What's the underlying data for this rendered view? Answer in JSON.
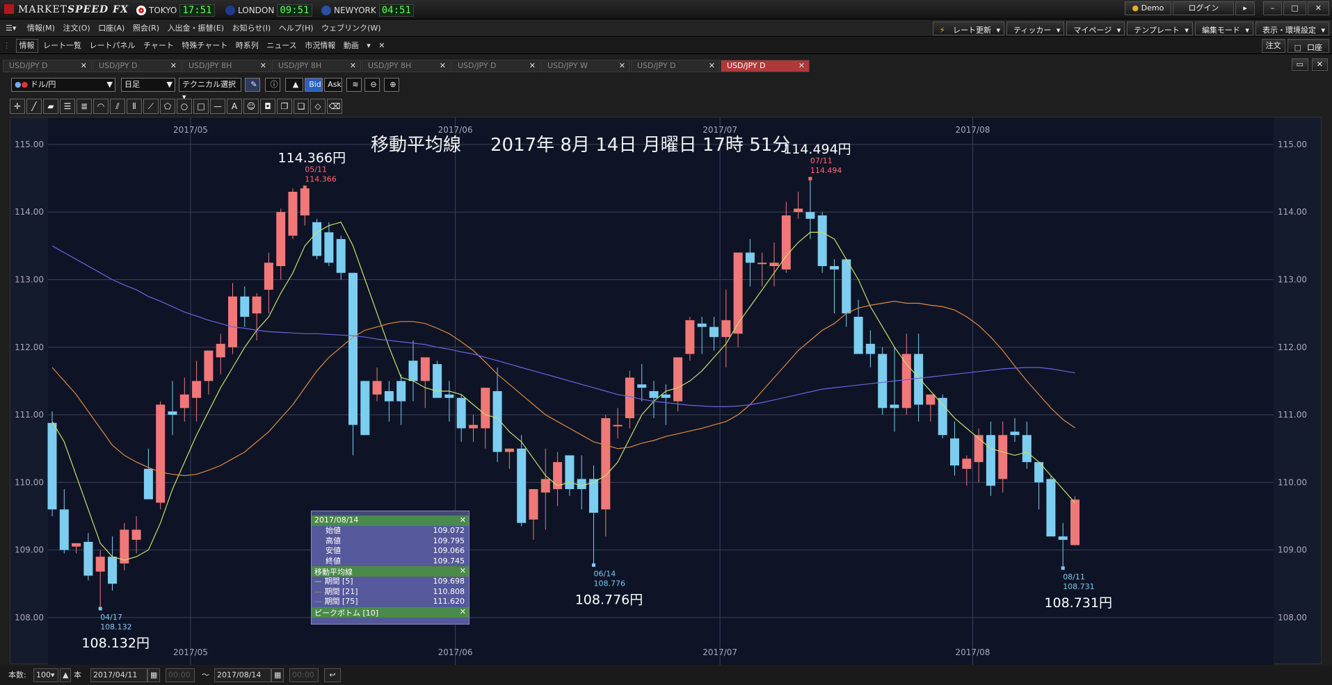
{
  "app": {
    "logo_plain": "MARKET",
    "logo_bold": "SPEED FX"
  },
  "clocks": [
    {
      "city": "TOKYO",
      "time": "17:51",
      "flag_color": "#d02020"
    },
    {
      "city": "LONDON",
      "time": "09:51",
      "flag_color": "#203a90"
    },
    {
      "city": "NEWYORK",
      "time": "04:51",
      "flag_color": "#2850a8"
    }
  ],
  "window_buttons": {
    "demo": "Demo",
    "login": "ログイン",
    "minimize": "–",
    "maximize": "□",
    "close": "✕"
  },
  "menu": [
    "情報(M)",
    "注文(O)",
    "口座(A)",
    "照会(R)",
    "入出金・振替(E)",
    "お知らせ(I)",
    "ヘルプ(H)",
    "ウェブリンク(W)"
  ],
  "menu_right": [
    "レート更新",
    "ティッカー",
    "マイページ",
    "テンプレート",
    "編集モード",
    "表示・環境設定"
  ],
  "nav": [
    "情報",
    "レート一覧",
    "レートパネル",
    "チャート",
    "特殊チャート",
    "時系列",
    "ニュース",
    "市況情報",
    "動画"
  ],
  "nav_right": [
    "注文",
    "口座"
  ],
  "tabs": [
    "USD/JPY D",
    "USD/JPY D",
    "USD/JPY 8H",
    "USD/JPY 8H",
    "USD/JPY 8H",
    "USD/JPY D",
    "USD/JPY W",
    "USD/JPY D",
    "USD/JPY D"
  ],
  "active_tab_index": 8,
  "controls": {
    "pair": "ドル/円",
    "period": "日足",
    "technical": "テクニカル選択",
    "bid": "Bid",
    "ask": "Ask"
  },
  "chart_data": {
    "type": "candlestick",
    "title": "移動平均線",
    "datetime": "2017年 8月 14日 月曜日 17時 51分",
    "ylim": [
      107.3,
      115.4
    ],
    "yticks": [
      "115.00",
      "114.00",
      "113.00",
      "112.00",
      "111.00",
      "110.00",
      "109.00",
      "108.00"
    ],
    "xticks": [
      "2017/05",
      "2017/06",
      "2017/07",
      "2017/08"
    ],
    "xtick_after_candle": [
      12,
      34,
      56,
      77
    ],
    "candles": [
      [
        110.88,
        111.05,
        109.5,
        109.6
      ],
      [
        109.6,
        109.9,
        108.95,
        109.0
      ],
      [
        109.05,
        109.1,
        108.95,
        109.1
      ],
      [
        109.12,
        109.25,
        108.55,
        108.62
      ],
      [
        108.68,
        109.0,
        108.12,
        108.9
      ],
      [
        108.9,
        109.2,
        108.4,
        108.5
      ],
      [
        108.8,
        109.4,
        108.7,
        109.3
      ],
      [
        109.15,
        109.5,
        108.95,
        109.3
      ],
      [
        110.2,
        110.5,
        109.8,
        109.75
      ],
      [
        109.7,
        111.2,
        109.6,
        111.15
      ],
      [
        111.05,
        111.5,
        110.7,
        111.0
      ],
      [
        111.1,
        111.55,
        110.9,
        111.3
      ],
      [
        111.25,
        111.8,
        110.9,
        111.5
      ],
      [
        111.5,
        111.9,
        111.3,
        111.95
      ],
      [
        111.85,
        112.2,
        111.6,
        112.05
      ],
      [
        112.0,
        112.95,
        111.9,
        112.75
      ],
      [
        112.75,
        112.9,
        112.3,
        112.45
      ],
      [
        112.5,
        112.8,
        112.1,
        112.75
      ],
      [
        112.85,
        113.4,
        112.5,
        113.25
      ],
      [
        113.2,
        114.05,
        113.0,
        114.0
      ],
      [
        113.65,
        114.35,
        113.6,
        114.3
      ],
      [
        113.95,
        114.366,
        113.8,
        114.35
      ],
      [
        113.85,
        113.9,
        113.3,
        113.35
      ],
      [
        113.7,
        113.85,
        113.2,
        113.25
      ],
      [
        113.6,
        113.65,
        113.0,
        113.1
      ],
      [
        113.1,
        113.1,
        110.4,
        110.85
      ],
      [
        111.5,
        111.5,
        110.7,
        110.7
      ],
      [
        111.3,
        111.7,
        111.2,
        111.5
      ],
      [
        111.35,
        111.5,
        110.9,
        111.2
      ],
      [
        111.5,
        111.6,
        110.85,
        111.2
      ],
      [
        111.8,
        112.1,
        111.2,
        111.5
      ],
      [
        111.5,
        111.75,
        111.1,
        111.85
      ],
      [
        111.75,
        111.8,
        111.3,
        111.25
      ],
      [
        111.3,
        111.5,
        110.9,
        111.25
      ],
      [
        111.25,
        111.3,
        110.6,
        110.8
      ],
      [
        110.8,
        111.0,
        110.6,
        110.85
      ],
      [
        110.8,
        111.4,
        110.5,
        111.4
      ],
      [
        111.35,
        111.7,
        110.3,
        110.45
      ],
      [
        110.45,
        110.5,
        110.2,
        110.5
      ],
      [
        110.5,
        110.7,
        109.35,
        109.4
      ],
      [
        109.45,
        109.9,
        109.15,
        109.9
      ],
      [
        109.85,
        110.5,
        109.3,
        110.05
      ],
      [
        109.9,
        110.45,
        109.65,
        110.3
      ],
      [
        110.4,
        110.4,
        109.8,
        109.9
      ],
      [
        110.05,
        110.4,
        109.6,
        109.9
      ],
      [
        110.05,
        110.25,
        108.776,
        109.55
      ],
      [
        109.6,
        111.0,
        109.2,
        110.95
      ],
      [
        110.85,
        111.1,
        110.65,
        110.85
      ],
      [
        110.95,
        111.65,
        110.8,
        111.55
      ],
      [
        111.45,
        111.75,
        111.2,
        111.4
      ],
      [
        111.35,
        111.5,
        110.95,
        111.25
      ],
      [
        111.3,
        111.45,
        110.85,
        111.25
      ],
      [
        111.2,
        111.45,
        111.05,
        111.85
      ],
      [
        111.9,
        112.45,
        111.8,
        112.4
      ],
      [
        112.35,
        112.45,
        111.9,
        112.3
      ],
      [
        112.3,
        112.45,
        111.95,
        112.15
      ],
      [
        112.15,
        112.85,
        111.7,
        112.4
      ],
      [
        112.2,
        112.95,
        112.0,
        113.4
      ],
      [
        113.4,
        113.6,
        112.9,
        113.25
      ],
      [
        113.25,
        113.4,
        112.9,
        113.25
      ],
      [
        113.2,
        113.55,
        112.9,
        113.25
      ],
      [
        113.15,
        114.15,
        113.1,
        113.95
      ],
      [
        114.0,
        114.3,
        113.9,
        114.05
      ],
      [
        114.0,
        114.494,
        113.6,
        113.9
      ],
      [
        113.95,
        114.0,
        113.1,
        113.2
      ],
      [
        113.2,
        113.3,
        112.5,
        113.15
      ],
      [
        113.3,
        113.3,
        112.3,
        112.5
      ],
      [
        112.45,
        112.7,
        112.1,
        111.9
      ],
      [
        112.05,
        112.25,
        111.7,
        111.9
      ],
      [
        111.9,
        112.0,
        111.0,
        111.1
      ],
      [
        111.15,
        112.0,
        110.75,
        111.1
      ],
      [
        111.1,
        112.2,
        111.0,
        111.9
      ],
      [
        111.9,
        112.2,
        110.9,
        111.15
      ],
      [
        111.15,
        111.3,
        110.9,
        111.3
      ],
      [
        111.25,
        111.3,
        110.65,
        110.7
      ],
      [
        110.65,
        110.9,
        110.1,
        110.25
      ],
      [
        110.2,
        110.4,
        109.95,
        110.35
      ],
      [
        110.3,
        110.8,
        110.0,
        110.7
      ],
      [
        110.7,
        110.9,
        109.8,
        109.95
      ],
      [
        110.05,
        110.9,
        109.85,
        110.7
      ],
      [
        110.75,
        110.95,
        110.6,
        110.7
      ],
      [
        110.7,
        110.9,
        110.2,
        110.3
      ],
      [
        110.3,
        110.3,
        109.6,
        110.0
      ],
      [
        110.05,
        110.1,
        109.2,
        109.2
      ],
      [
        109.2,
        109.4,
        108.731,
        109.15
      ],
      [
        109.072,
        109.795,
        109.066,
        109.745
      ]
    ],
    "ma_series": [
      {
        "name": "期間 [5]",
        "color": "#c8e068",
        "values": [
          110.9,
          110.6,
          110.1,
          109.6,
          109.1,
          108.9,
          108.85,
          108.9,
          109.0,
          109.4,
          109.9,
          110.3,
          110.7,
          111.05,
          111.4,
          111.7,
          112.0,
          112.25,
          112.45,
          112.8,
          113.1,
          113.5,
          113.7,
          113.8,
          113.85,
          113.5,
          113.0,
          112.5,
          112.0,
          111.55,
          111.5,
          111.4,
          111.35,
          111.35,
          111.3,
          111.15,
          111.0,
          110.95,
          110.75,
          110.6,
          110.35,
          110.1,
          109.95,
          110.0,
          109.95,
          110.0,
          110.1,
          110.3,
          110.65,
          111.0,
          111.2,
          111.35,
          111.4,
          111.5,
          111.65,
          111.85,
          112.05,
          112.35,
          112.6,
          112.85,
          113.1,
          113.35,
          113.55,
          113.7,
          113.7,
          113.6,
          113.3,
          113.0,
          112.6,
          112.3,
          112.0,
          111.75,
          111.55,
          111.35,
          111.15,
          110.95,
          110.8,
          110.65,
          110.5,
          110.45,
          110.4,
          110.45,
          110.3,
          110.1,
          109.9,
          109.698
        ]
      },
      {
        "name": "期間 [21]",
        "color": "#e08a40",
        "values": [
          111.7,
          111.5,
          111.3,
          111.05,
          110.8,
          110.55,
          110.4,
          110.3,
          110.22,
          110.15,
          110.12,
          110.1,
          110.12,
          110.18,
          110.25,
          110.35,
          110.45,
          110.6,
          110.75,
          110.95,
          111.15,
          111.4,
          111.65,
          111.85,
          112.0,
          112.15,
          112.25,
          112.3,
          112.35,
          112.38,
          112.38,
          112.35,
          112.28,
          112.2,
          112.08,
          111.95,
          111.78,
          111.6,
          111.45,
          111.3,
          111.15,
          111.0,
          110.9,
          110.8,
          110.7,
          110.6,
          110.55,
          110.5,
          110.52,
          110.58,
          110.62,
          110.68,
          110.72,
          110.76,
          110.8,
          110.85,
          110.9,
          111.0,
          111.15,
          111.35,
          111.55,
          111.75,
          111.95,
          112.1,
          112.25,
          112.35,
          112.5,
          112.58,
          112.62,
          112.65,
          112.68,
          112.65,
          112.65,
          112.62,
          112.6,
          112.55,
          112.45,
          112.32,
          112.15,
          111.95,
          111.72,
          111.5,
          111.3,
          111.1,
          110.93,
          110.808
        ]
      },
      {
        "name": "期間 [75]",
        "color": "#6a64e0",
        "values": [
          113.5,
          113.4,
          113.3,
          113.2,
          113.1,
          113.0,
          112.92,
          112.85,
          112.75,
          112.68,
          112.6,
          112.52,
          112.46,
          112.4,
          112.35,
          112.3,
          112.28,
          112.25,
          112.23,
          112.22,
          112.21,
          112.2,
          112.2,
          112.19,
          112.18,
          112.17,
          112.15,
          112.12,
          112.1,
          112.08,
          112.06,
          112.04,
          112.0,
          111.97,
          111.93,
          111.9,
          111.85,
          111.8,
          111.75,
          111.7,
          111.65,
          111.6,
          111.55,
          111.5,
          111.45,
          111.4,
          111.35,
          111.3,
          111.27,
          111.23,
          111.2,
          111.18,
          111.16,
          111.14,
          111.13,
          111.12,
          111.12,
          111.13,
          111.15,
          111.18,
          111.22,
          111.26,
          111.3,
          111.34,
          111.38,
          111.4,
          111.42,
          111.44,
          111.46,
          111.48,
          111.5,
          111.52,
          111.54,
          111.56,
          111.58,
          111.6,
          111.62,
          111.64,
          111.66,
          111.68,
          111.69,
          111.7,
          111.7,
          111.68,
          111.65,
          111.62
        ]
      }
    ],
    "annotations": [
      {
        "candle": 21,
        "price": 114.366,
        "big": "114.366円",
        "date": "05/11",
        "value": "114.366",
        "side": "high"
      },
      {
        "candle": 63,
        "price": 114.494,
        "big": "114.494円",
        "date": "07/11",
        "value": "114.494",
        "side": "high"
      },
      {
        "candle": 4,
        "price": 108.132,
        "big": "108.132円",
        "date": "04/17",
        "value": "108.132",
        "side": "low"
      },
      {
        "candle": 45,
        "price": 108.776,
        "big": "108.776円",
        "date": "06/14",
        "value": "108.776",
        "side": "low"
      },
      {
        "candle": 84,
        "price": 108.731,
        "big": "108.731円",
        "date": "08/11",
        "value": "108.731",
        "side": "low"
      }
    ]
  },
  "info_panel": {
    "date": "2017/08/14",
    "ohlc": [
      [
        "始値",
        "109.072"
      ],
      [
        "高値",
        "109.795"
      ],
      [
        "安値",
        "109.066"
      ],
      [
        "終値",
        "109.745"
      ]
    ],
    "ma_title": "移動平均線",
    "ma_rows": [
      [
        "期間 [5]",
        "109.698"
      ],
      [
        "期間 [21]",
        "110.808"
      ],
      [
        "期間 [75]",
        "111.620"
      ]
    ],
    "peak_title": "ピークボトム [10]"
  },
  "status": {
    "count_label": "本数:",
    "count": "100",
    "unit": "本",
    "date_from": "2017/04/11",
    "time_from": "00:00",
    "tilde": "〜",
    "date_to": "2017/08/14",
    "time_to": "00:00"
  }
}
